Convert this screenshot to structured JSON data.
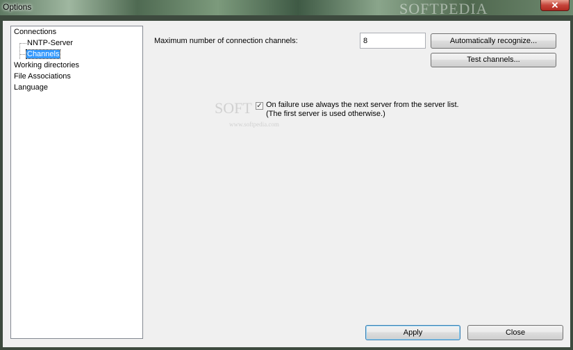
{
  "window": {
    "title": "Options",
    "close_glyph": "✕",
    "watermark": "SOFTPEDIA"
  },
  "tree": {
    "items": [
      {
        "label": "Connections"
      },
      {
        "label": "NNTP-Server"
      },
      {
        "label": "Channels",
        "selected": true
      },
      {
        "label": "Working directories"
      },
      {
        "label": "File Associations"
      },
      {
        "label": "Language"
      }
    ]
  },
  "channels": {
    "max_label": "Maximum number of connection channels:",
    "max_value": "8",
    "auto_button": "Automatically recognize...",
    "test_button": "Test channels...",
    "failover_checked": true,
    "failover_line1": "On failure use always the next server from the server list.",
    "failover_line2": "(The first server is used otherwise.)"
  },
  "watermark_mid": {
    "logo": "SOFT",
    "url": "www.softpedia.com"
  },
  "footer": {
    "apply": "Apply",
    "close": "Close"
  },
  "colors": {
    "selection": "#3399ff",
    "dialog_bg": "#f0f0f0"
  }
}
